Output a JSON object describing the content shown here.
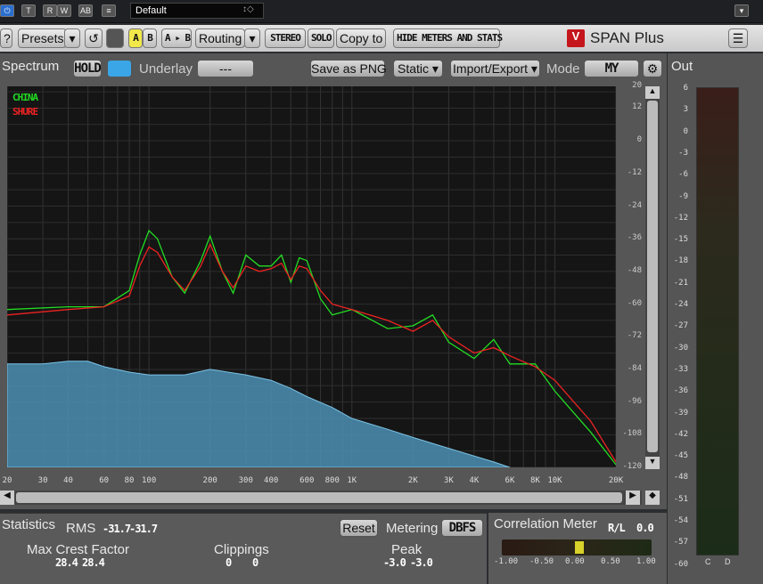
{
  "host": {
    "preset_name": "Default",
    "buttons": [
      "power",
      "T",
      "R",
      "W",
      "AB",
      "menu"
    ]
  },
  "toolbar": {
    "help": "?",
    "presets": "Presets",
    "ab_a": "A",
    "ab_b": "B",
    "a_to_b": "A ▸ B",
    "routing": "Routing",
    "stereo": "STEREO",
    "solo": "SOLO",
    "copy_to": "Copy to",
    "hide_meters": "HIDE METERS AND STATS",
    "brand": "SPAN Plus"
  },
  "spectrum": {
    "tab": "Spectrum",
    "hold": "HOLD",
    "underlay_label": "Underlay",
    "underlay_value": "---",
    "save_png": "Save as PNG",
    "static": "Static ▾",
    "import_export": "Import/Export ▾",
    "mode_label": "Mode",
    "mode_value": "MY",
    "legend": [
      {
        "name": "CHINA",
        "color": "#22dd22"
      },
      {
        "name": "SHURE",
        "color": "#ee2222"
      }
    ]
  },
  "out": {
    "tab": "Out",
    "ticks": [
      "6",
      "3",
      "0",
      "-3",
      "-6",
      "-9",
      "-12",
      "-15",
      "-18",
      "-21",
      "-24",
      "-27",
      "-30",
      "-33",
      "-36",
      "-39",
      "-42",
      "-45",
      "-48",
      "-51",
      "-54",
      "-57",
      "-60"
    ],
    "channels": [
      "C",
      "D"
    ]
  },
  "statistics": {
    "tab": "Statistics",
    "rms_label": "RMS",
    "rms": [
      "-31.7",
      "-31.7"
    ],
    "reset": "Reset",
    "metering_label": "Metering",
    "metering_value": "DBFS",
    "crest_label": "Max Crest Factor",
    "crest": [
      "28.4",
      "28.4"
    ],
    "clip_label": "Clippings",
    "clip": [
      "0",
      "0"
    ],
    "peak_label": "Peak",
    "peak": [
      "-3.0",
      "-3.0"
    ]
  },
  "correlation": {
    "title": "Correlation Meter",
    "mode": "R/L",
    "value": "0.0",
    "ticks": [
      "-1.00",
      "-0.50",
      "0.00",
      "0.50",
      "1.00"
    ]
  },
  "chart_data": {
    "type": "line",
    "xscale": "log",
    "xlim": [
      20,
      20000
    ],
    "ylim": [
      -120,
      20
    ],
    "x_ticks": [
      "20",
      "30",
      "40",
      "60",
      "80",
      "100",
      "200",
      "300",
      "400",
      "600",
      "800",
      "1K",
      "2K",
      "3K",
      "4K",
      "6K",
      "8K",
      "10K",
      "20K"
    ],
    "x_tick_values": [
      20,
      30,
      40,
      60,
      80,
      100,
      200,
      300,
      400,
      600,
      800,
      1000,
      2000,
      3000,
      4000,
      6000,
      8000,
      10000,
      20000
    ],
    "y_ticks": [
      "20",
      "12",
      "0",
      "-12",
      "-24",
      "-36",
      "-48",
      "-60",
      "-72",
      "-84",
      "-96",
      "-108",
      "-120"
    ],
    "y_tick_values": [
      20,
      12,
      0,
      -12,
      -24,
      -36,
      -48,
      -60,
      -72,
      -84,
      -96,
      -108,
      -120
    ],
    "series": [
      {
        "name": "CHINA",
        "color": "#22dd22",
        "x": [
          20,
          40,
          60,
          80,
          90,
          100,
          110,
          130,
          150,
          180,
          200,
          230,
          260,
          300,
          350,
          400,
          450,
          500,
          550,
          600,
          700,
          800,
          1000,
          1500,
          2000,
          2500,
          3000,
          4000,
          5000,
          6000,
          8000,
          10000,
          15000,
          20000
        ],
        "y": [
          -62,
          -61,
          -61,
          -55,
          -42,
          -33,
          -36,
          -50,
          -56,
          -44,
          -35,
          -48,
          -56,
          -42,
          -46,
          -46,
          -42,
          -52,
          -43,
          -44,
          -58,
          -64,
          -62,
          -69,
          -68,
          -64,
          -74,
          -80,
          -73,
          -82,
          -82,
          -92,
          -107,
          -119
        ]
      },
      {
        "name": "SHURE",
        "color": "#ee2222",
        "x": [
          20,
          40,
          60,
          80,
          90,
          100,
          110,
          130,
          150,
          180,
          200,
          230,
          260,
          300,
          350,
          400,
          450,
          500,
          550,
          600,
          700,
          800,
          1000,
          1500,
          2000,
          2500,
          3000,
          4000,
          5000,
          6000,
          8000,
          10000,
          15000,
          20000
        ],
        "y": [
          -64,
          -62,
          -61,
          -57,
          -46,
          -39,
          -41,
          -50,
          -55,
          -46,
          -38,
          -48,
          -54,
          -46,
          -48,
          -47,
          -45,
          -51,
          -46,
          -47,
          -55,
          -60,
          -62,
          -66,
          -70,
          -66,
          -72,
          -78,
          -76,
          -79,
          -83,
          -88,
          -103,
          -118
        ]
      },
      {
        "name": "Underlay",
        "color": "#5aa6cc",
        "x": [
          20,
          30,
          40,
          50,
          60,
          80,
          100,
          150,
          200,
          300,
          400,
          500,
          600,
          800,
          1000,
          1500,
          2000,
          3000,
          5000,
          6000
        ],
        "y": [
          -82,
          -82,
          -81,
          -81,
          -83,
          -85,
          -86,
          -86,
          -84,
          -86,
          -88,
          -91,
          -94,
          -98,
          -102,
          -106,
          -109,
          -113,
          -118,
          -120
        ]
      }
    ]
  }
}
